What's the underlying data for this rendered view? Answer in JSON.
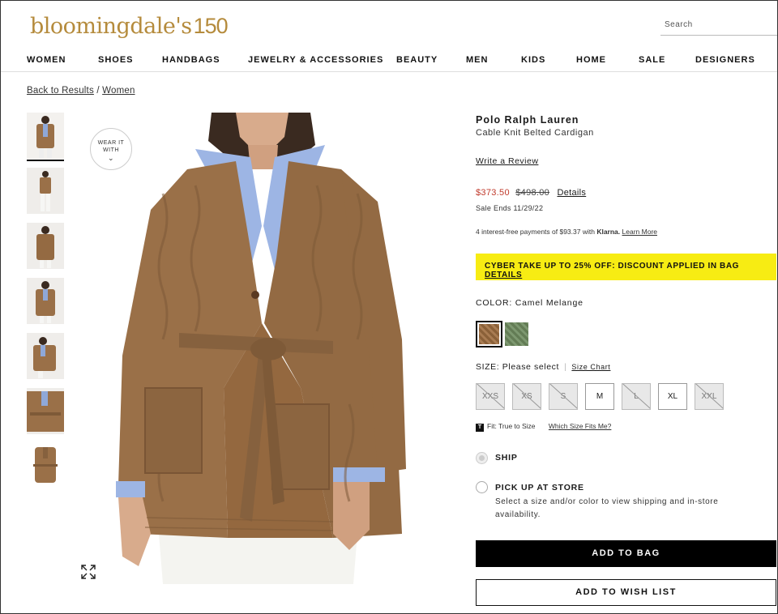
{
  "header": {
    "logo_text": "bloomingdale's",
    "logo_number": "150",
    "search_placeholder": "Search"
  },
  "nav": {
    "items": [
      "WOMEN",
      "SHOES",
      "HANDBAGS",
      "JEWELRY & ACCESSORIES",
      "BEAUTY",
      "MEN",
      "KIDS",
      "HOME",
      "SALE",
      "DESIGNERS"
    ]
  },
  "breadcrumb": {
    "back": "Back to Results",
    "separator": "/",
    "category": "Women"
  },
  "gallery": {
    "wear_it_with": "WEAR IT WITH",
    "thumbnail_count": 7,
    "zoom_icon": "expand-icon"
  },
  "product": {
    "brand": "Polo Ralph Lauren",
    "name": "Cable Knit Belted Cardigan",
    "write_review": "Write a Review",
    "sale_price": "$373.50",
    "original_price": "$498.00",
    "details_link": "Details",
    "sale_ends": "Sale Ends 11/29/22",
    "klarna_prefix": "4 interest-free payments of $93.37 with",
    "klarna_brand": "Klarna.",
    "klarna_learn": "Learn More",
    "promo_text": "CYBER TAKE UP TO 25% OFF: DISCOUNT APPLIED IN BAG",
    "promo_link": "DETAILS",
    "color_label": "COLOR:",
    "color_value": "Camel Melange",
    "size_label": "SIZE:",
    "size_value": "Please select",
    "size_chart": "Size Chart",
    "sizes": [
      {
        "label": "XXS",
        "available": false
      },
      {
        "label": "XS",
        "available": false
      },
      {
        "label": "S",
        "available": false
      },
      {
        "label": "M",
        "available": true
      },
      {
        "label": "L",
        "available": false
      },
      {
        "label": "XL",
        "available": true
      },
      {
        "label": "XXL",
        "available": false
      }
    ],
    "fit_badge": "T",
    "fit_text": "Fit: True to Size",
    "fit_link": "Which Size Fits Me?",
    "ship_label": "SHIP",
    "pickup_label": "PICK UP AT STORE",
    "pickup_note": "Select a size and/or color to view shipping and in-store availability.",
    "add_to_bag": "ADD TO BAG",
    "add_to_wishlist": "ADD TO WISH LIST"
  },
  "colors": {
    "brand_gold": "#b58b3c",
    "sale_red": "#c0392b",
    "promo_yellow": "#f7ec13",
    "swatch_camel": "#9a7048",
    "swatch_green": "#6f8a60"
  }
}
